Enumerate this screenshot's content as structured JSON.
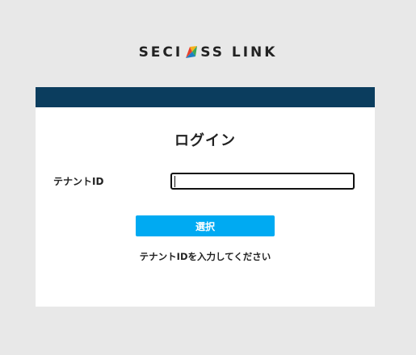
{
  "logo": {
    "left_text": "SECI",
    "right_text": "SS LINK",
    "mark_icon": "seciss-logo-mark-icon",
    "mark_colors": [
      "#e8412b",
      "#f6b21a",
      "#3aa957",
      "#1d7fc4"
    ]
  },
  "header": {
    "color": "#0b3d5e"
  },
  "login": {
    "title": "ログイン",
    "tenant_label": "テナントID",
    "tenant_value": "",
    "submit_label": "選択",
    "hint": "テナントIDを入力してください"
  },
  "colors": {
    "accent": "#00aaf2",
    "background": "#e8e8e8"
  }
}
